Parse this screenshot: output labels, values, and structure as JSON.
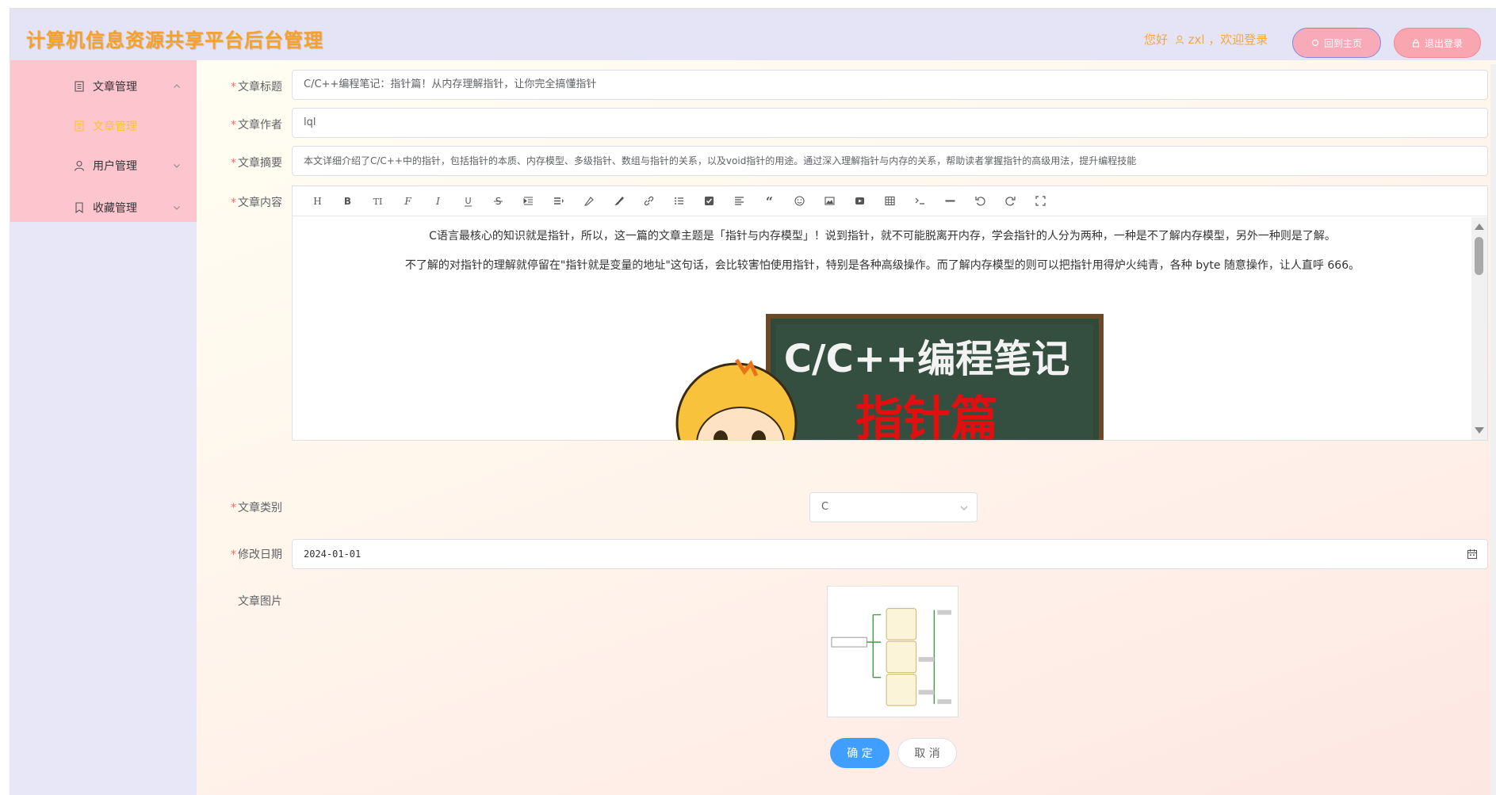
{
  "header": {
    "title": "计算机信息资源共享平台后台管理",
    "greeting_prefix": "您好",
    "username": "zxl",
    "greeting_suffix": "，欢迎登录",
    "home_button": "回到主页",
    "logout_button": "退出登录"
  },
  "sidebar": {
    "items": [
      {
        "label": "文章管理",
        "icon": "document-icon",
        "expanded": true
      },
      {
        "label": "文章管理",
        "icon": "document-icon",
        "active": true
      },
      {
        "label": "用户管理",
        "icon": "user-icon",
        "expanded": false
      },
      {
        "label": "收藏管理",
        "icon": "bookmark-icon",
        "expanded": false
      }
    ]
  },
  "form": {
    "title": {
      "label": "文章标题",
      "value": "C/C++编程笔记：指针篇！从内存理解指针，让你完全搞懂指针"
    },
    "author": {
      "label": "文章作者",
      "value": "lql"
    },
    "summary": {
      "label": "文章摘要",
      "value": "本文详细介绍了C/C++中的指针，包括指针的本质、内存模型、多级指针、数组与指针的关系，以及void指针的用途。通过深入理解指针与内存的关系，帮助读者掌握指针的高级用法，提升编程技能"
    },
    "content": {
      "label": "文章内容",
      "paragraphs": [
        "C语言最核心的知识就是指针，所以，这一篇的文章主题是「指针与内存模型」！说到指针，就不可能脱离开内存，学会指针的人分为两种，一种是不了解内存模型，另外一种则是了解。",
        "不了解的对指针的理解就停留在\"指针就是变量的地址\"这句话，会比较害怕使用指针，特别是各种高级操作。而了解内存模型的则可以把指针用得炉火纯青，各种 byte 随意操作，让人直呼 666。"
      ],
      "image_title": "C/C++编程笔记",
      "image_subtitle": "指针篇"
    },
    "category": {
      "label": "文章类别",
      "value": "C"
    },
    "date": {
      "label": "修改日期",
      "value": "2024-01-01"
    },
    "picture": {
      "label": "文章图片"
    }
  },
  "buttons": {
    "ok": "确 定",
    "cancel": "取 消"
  },
  "toolbar": [
    "heading-icon",
    "bold-icon",
    "font-size-icon",
    "font-family-icon",
    "italic-icon",
    "underline-icon",
    "strikethrough-icon",
    "indent-icon",
    "line-height-icon",
    "font-color-icon",
    "bg-color-icon",
    "link-icon",
    "list-icon",
    "todo-icon",
    "justify-icon",
    "quote-icon",
    "emoticon-icon",
    "image-icon",
    "video-icon",
    "table-icon",
    "code-icon",
    "divider-icon",
    "undo-icon",
    "redo-icon",
    "fullscreen-icon"
  ],
  "colors": {
    "accent": "#409eff",
    "title": "#f7a02a",
    "sidebar_menu": "#fdc6cf",
    "header": "#e5e4f6"
  }
}
